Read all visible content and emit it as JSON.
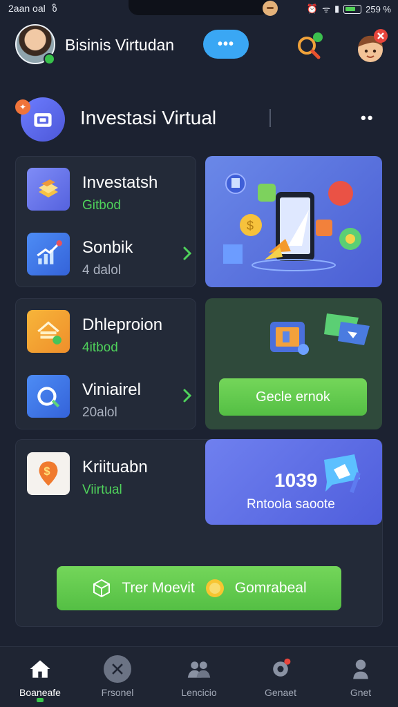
{
  "status_bar": {
    "time_text": "2aan oal",
    "battery_text": "259 %"
  },
  "header": {
    "app_title": "Bisinis Virtudan",
    "menu_label": "•••"
  },
  "section": {
    "title": "Investasi Virtual",
    "more_label": "••"
  },
  "items": [
    {
      "title": "Investatsh",
      "sub": "Gitbod",
      "icon": "stack-icon"
    },
    {
      "title": "Sonbik",
      "sub": "4 dalol",
      "icon": "growth-chart-icon"
    },
    {
      "title": "Dhleproion",
      "sub": "4itbod",
      "icon": "home-stack-icon"
    },
    {
      "title": "Viniairel",
      "sub": "20alol",
      "icon": "target-icon"
    },
    {
      "title": "Kriituabn",
      "sub": "Viirtual",
      "icon": "dollar-pin-icon"
    }
  ],
  "promo_green": {
    "button_label": "Gecle ernok"
  },
  "promo_violet": {
    "number": "1039",
    "caption": "Rntoola saoote"
  },
  "cta": {
    "left_label": "Trer Moevit",
    "right_label": "Gomrabeal"
  },
  "bottom_nav": [
    {
      "label": "Boaneafe",
      "icon": "home-icon",
      "active": true
    },
    {
      "label": "Frsonel",
      "icon": "tools-icon",
      "active": false
    },
    {
      "label": "Lencicio",
      "icon": "people-icon",
      "active": false
    },
    {
      "label": "Genaet",
      "icon": "settings-icon",
      "active": false
    },
    {
      "label": "Gnet",
      "icon": "profile-icon",
      "active": false
    }
  ],
  "colors": {
    "background": "#1c2231",
    "card": "#232a38",
    "accent_green": "#4fd25b",
    "accent_blue": "#3aa7f4",
    "promo_blue": "#5a73df"
  }
}
